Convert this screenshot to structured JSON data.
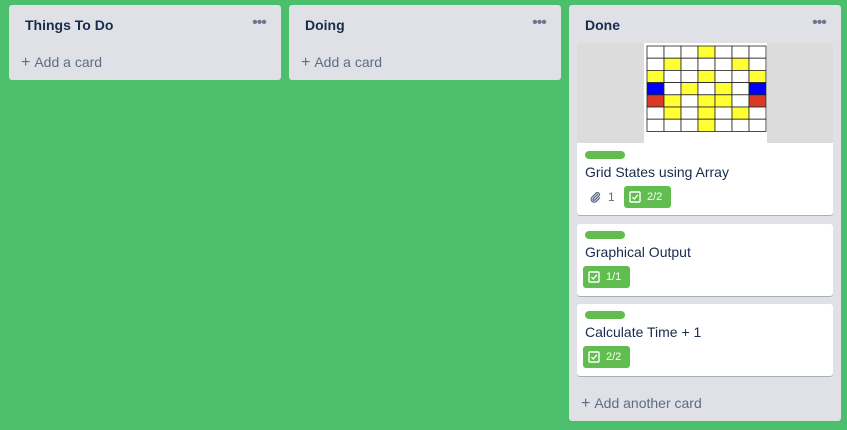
{
  "board": {
    "background": "#4bbf6b",
    "lists": [
      {
        "title": "Things To Do",
        "add_label": "Add a card"
      },
      {
        "title": "Doing",
        "add_label": "Add a card"
      },
      {
        "title": "Done",
        "add_label": "Add another card"
      }
    ],
    "menu_glyph": "•••",
    "plus_glyph": "+"
  },
  "done_cards": [
    {
      "title": "Grid States using Array",
      "label_color": "#61bd4f",
      "attachments": "1",
      "checklist": "2/2",
      "cover_grid": {
        "rows": 6,
        "cols": 7,
        "colors": {
          "w": "#ffffff",
          "y": "#ffff33",
          "b": "#0000ff",
          "r": "#d93a26"
        },
        "cells": [
          "wwwywww",
          "wywwwyw",
          "ywwywwy",
          "bwywywb",
          "rywyywr",
          "wywywyw"
        ],
        "extra_row": "wwwywww"
      }
    },
    {
      "title": "Graphical Output",
      "label_color": "#61bd4f",
      "checklist": "1/1"
    },
    {
      "title": "Calculate Time + 1",
      "label_color": "#61bd4f",
      "checklist": "2/2"
    }
  ]
}
